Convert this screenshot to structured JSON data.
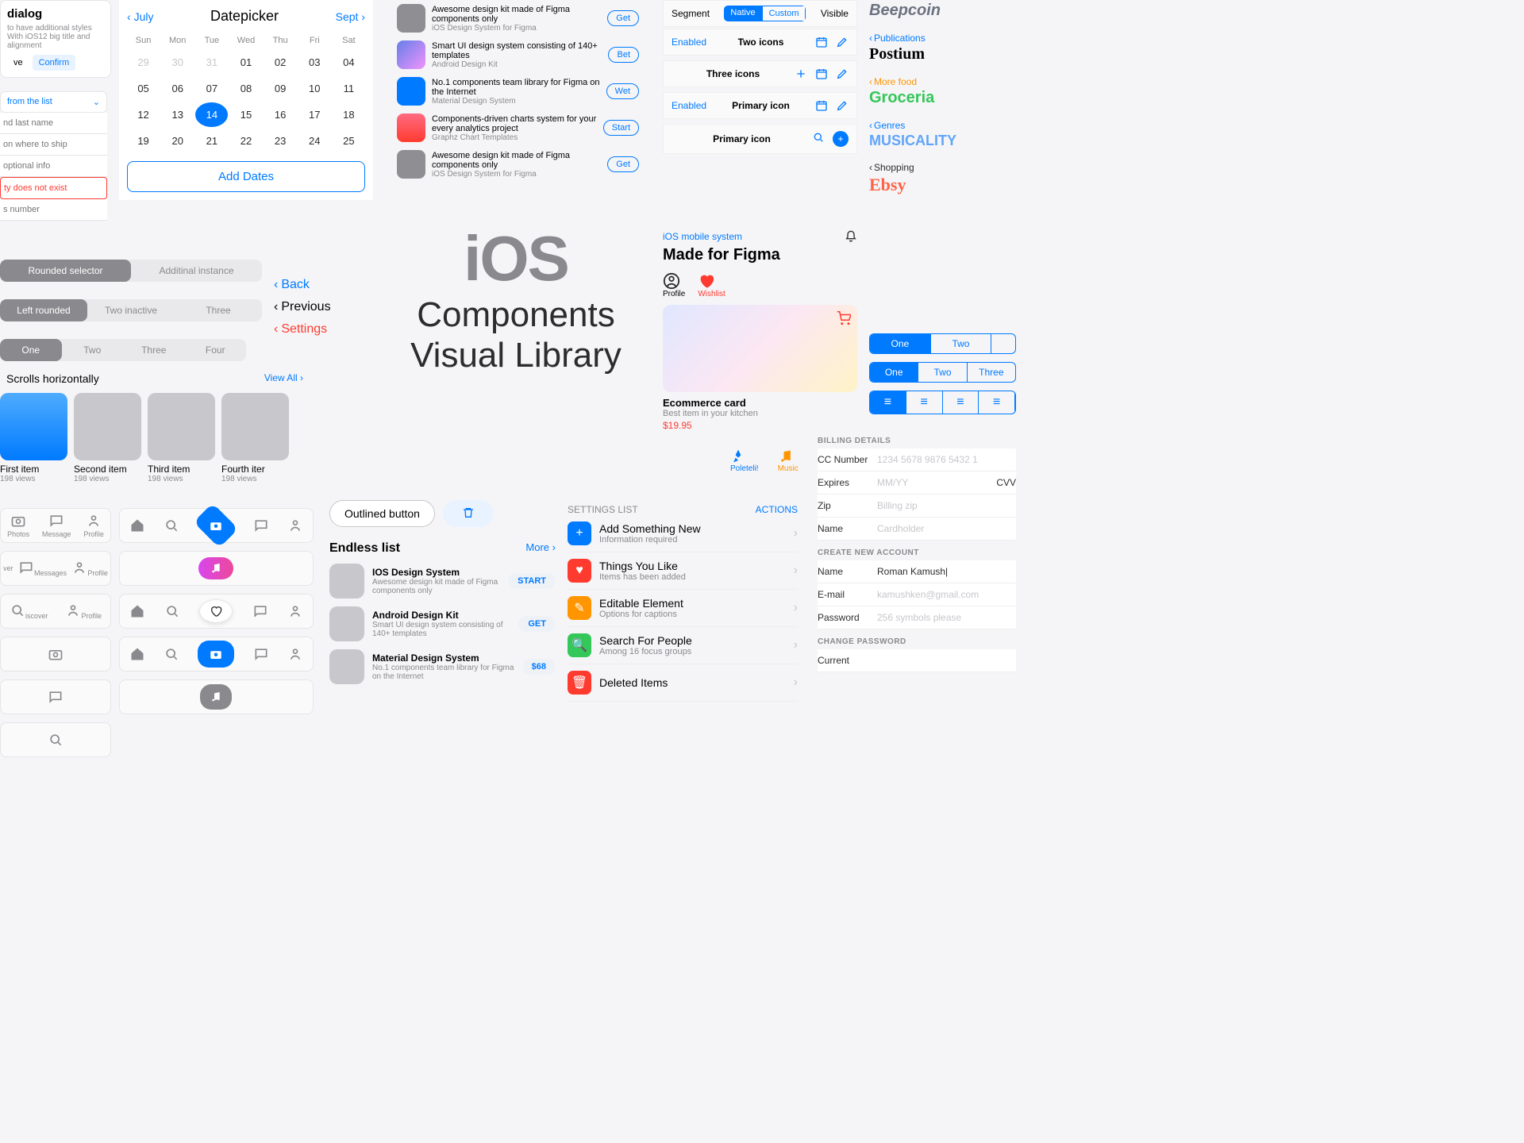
{
  "dialog": {
    "title": "dialog",
    "desc": "to have additional styles With iOS12 big title and alignment",
    "save": "ve",
    "confirm": "Confirm"
  },
  "form": {
    "select": "from the list",
    "ph1": "nd last name",
    "ph2": "on where to ship",
    "ph3": "optional info",
    "err": "ty does not exist",
    "ph4": "s number"
  },
  "datepicker": {
    "prev": "July",
    "title": "Datepicker",
    "next": "Sept",
    "dow": [
      "Sun",
      "Mon",
      "Tue",
      "Wed",
      "Thu",
      "Fri",
      "Sat"
    ],
    "prevDays": [
      29,
      30,
      31
    ],
    "days": [
      1,
      2,
      3,
      4,
      5,
      6,
      7,
      8,
      9,
      10,
      11,
      12,
      13,
      14,
      15,
      16,
      17,
      18,
      19,
      20,
      21,
      22,
      23,
      24,
      25
    ],
    "selected": 14,
    "add": "Add Dates"
  },
  "segs": {
    "a": [
      "Rounded selector",
      "Additinal instance"
    ],
    "b": [
      "Left rounded",
      "Two inactive",
      "Three"
    ],
    "c": [
      "One",
      "Two",
      "Three",
      "Four"
    ]
  },
  "backlinks": {
    "back": "Back",
    "prev": "Previous",
    "settings": "Settings"
  },
  "scroll": {
    "title": "Scrolls horizontally",
    "viewall": "View All",
    "items": [
      {
        "t": "First item",
        "s": "198 views"
      },
      {
        "t": "Second item",
        "s": "198 views"
      },
      {
        "t": "Third item",
        "s": "198 views"
      },
      {
        "t": "Fourth iter",
        "s": "198 views"
      }
    ]
  },
  "tabbar_labels": {
    "photos": "Photos",
    "message": "Message",
    "messages": "Messages",
    "profile": "Profile",
    "discover": "iscover",
    "over": "ver"
  },
  "applist": [
    {
      "t": "Awesome design kit made of Figma components only",
      "s": "iOS Design System for Figma",
      "btn": "Get",
      "c": "#8e8e93"
    },
    {
      "t": "Smart UI design system consisting of 140+ templates",
      "s": "Android Design Kit",
      "btn": "Bet",
      "c": "linear-gradient(135deg,#667eea,#f093fb)"
    },
    {
      "t": "No.1 components team library for Figma on the Internet",
      "s": "Material Design System",
      "btn": "Wet",
      "c": "#007aff"
    },
    {
      "t": "Components-driven charts system for your every analytics project",
      "s": "Graphz Chart Templates",
      "btn": "Start",
      "c": "linear-gradient(#ff6b81,#ff3b30)"
    },
    {
      "t": "Awesome design kit made of Figma components only",
      "s": "iOS Design System for Figma",
      "btn": "Get",
      "c": "#8e8e93"
    }
  ],
  "hero": {
    "ios": "iOS",
    "sub1": "Components",
    "sub2": "Visual Library"
  },
  "topseg": {
    "segment": "Segment",
    "native": "Native",
    "custom": "Custom",
    "visible": "Visible"
  },
  "headers": [
    {
      "left": "Enabled",
      "mid": "Two icons",
      "icons": [
        "cal",
        "edit"
      ]
    },
    {
      "left": "",
      "mid": "Three icons",
      "icons": [
        "plus",
        "cal",
        "edit"
      ]
    },
    {
      "left": "Enabled",
      "mid": "Primary icon",
      "icons": [
        "cal",
        "edit"
      ]
    },
    {
      "left": "",
      "mid": "Primary icon",
      "icons": [
        "search",
        "plusfill"
      ]
    }
  ],
  "mff": {
    "small": "iOS mobile system",
    "title": "Made for Figma",
    "profile": "Profile",
    "wishlist": "Wishlist",
    "etitle": "Ecommerce card",
    "esub": "Best item in your kitchen",
    "eprice": "$19.95",
    "bell": "bell"
  },
  "tiny": {
    "a": "Poleteli!",
    "b": "Music"
  },
  "outlined": {
    "btn": "Outlined button"
  },
  "endless": {
    "title": "Endless list",
    "more": "More",
    "items": [
      {
        "t": "IOS Design System",
        "s": "Awesome design kit made of Figma components only",
        "btn": "START"
      },
      {
        "t": "Android Design Kit",
        "s": "Smart UI design system consisting of 140+ templates",
        "btn": "GET"
      },
      {
        "t": "Material Design System",
        "s": "No.1 components team library for Figma on the Internet",
        "btn": "$68"
      }
    ]
  },
  "settings": {
    "head": "SETTINGS LIST",
    "actions": "ACTIONS",
    "items": [
      {
        "t": "Add Something New",
        "s": "Information required",
        "c": "#007aff",
        "icon": "plus"
      },
      {
        "t": "Things You Like",
        "s": "Items has been added",
        "c": "#ff3b30",
        "icon": "heart"
      },
      {
        "t": "Editable Element",
        "s": "Options for captions",
        "c": "#ff9500",
        "icon": "pencil"
      },
      {
        "t": "Search For People",
        "s": "Among 16 focus groups",
        "c": "#34c759",
        "icon": "search"
      },
      {
        "t": "Deleted Items",
        "s": "",
        "c": "#ff3b30",
        "icon": "trash"
      }
    ]
  },
  "brands": [
    {
      "back": "",
      "logo": "Beepcoin",
      "bc": "#8a8a8e",
      "lc": "#6b7280",
      "font": "italic 900 20px sans-serif"
    },
    {
      "back": "Publications",
      "logo": "Postium",
      "bc": "#007aff",
      "lc": "#000",
      "font": "900 20px Georgia,serif"
    },
    {
      "back": "More food",
      "logo": "Groceria",
      "bc": "#ff9500",
      "lc": "#34c759",
      "font": "900 20px sans-serif"
    },
    {
      "back": "Genres",
      "logo": "MUSICALITY",
      "bc": "#007aff",
      "lc": "#60a5fa",
      "font": "900 18px sans-serif"
    },
    {
      "back": "Shopping",
      "logo": "Ebsy",
      "bc": "#2c2c2e",
      "lc": "#ff6347",
      "font": "900 22px Georgia,serif"
    }
  ],
  "segblue": {
    "r1": [
      "One",
      "Two"
    ],
    "r2": [
      "One",
      "Two",
      "Three"
    ]
  },
  "billing": {
    "h1": "BILLING DETAILS",
    "rows1": [
      {
        "l": "CC Number",
        "v": "1234 5678 9876 5432 1"
      },
      {
        "l": "Expires",
        "v": "MM/YY",
        "extra": "CVV"
      },
      {
        "l": "Zip",
        "v": "Billing zip"
      },
      {
        "l": "Name",
        "v": "Cardholder"
      }
    ],
    "h2": "CREATE NEW ACCOUNT",
    "rows2": [
      {
        "l": "Name",
        "v": "Roman Kamush|",
        "filled": true
      },
      {
        "l": "E-mail",
        "v": "kamushken@gmail.com"
      },
      {
        "l": "Password",
        "v": "256 symbols please"
      }
    ],
    "h3": "CHANGE PASSWORD",
    "rows3": [
      {
        "l": "Current",
        "v": ""
      }
    ]
  }
}
